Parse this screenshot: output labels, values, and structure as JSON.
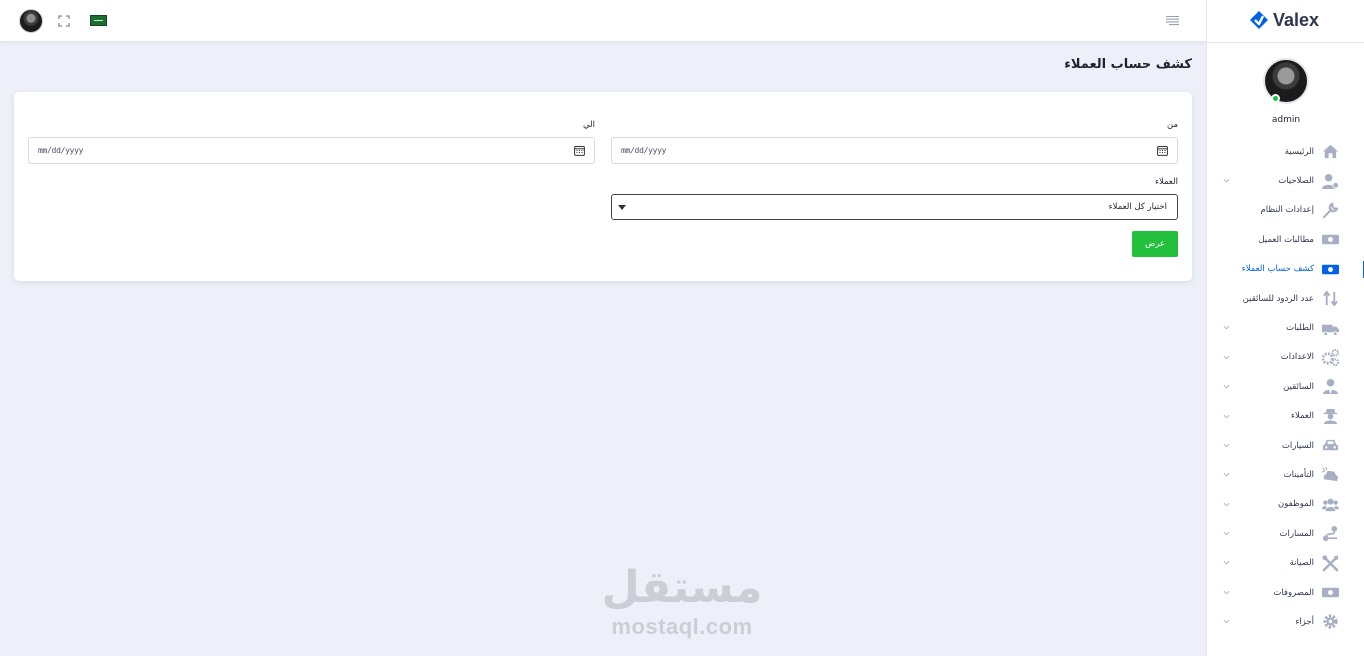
{
  "brand": {
    "name": "Valex"
  },
  "user": {
    "name": "admin"
  },
  "page": {
    "title": "كشف حساب العملاء"
  },
  "form": {
    "from_label": "من",
    "to_label": "الي",
    "from_placeholder": "mm/dd/yyyy",
    "to_placeholder": "mm/dd/yyyy",
    "customers_label": "العملاء",
    "customers_selected": "اختيار كل العملاء",
    "submit_label": "عرض"
  },
  "sidebar": {
    "items": [
      {
        "label": "الرئيسية",
        "icon": "home-icon",
        "has_submenu": false,
        "active": false
      },
      {
        "label": "الصلاحيات",
        "icon": "user-gear-icon",
        "has_submenu": true,
        "active": false
      },
      {
        "label": "إعدادات النظام",
        "icon": "wrench-icon",
        "has_submenu": false,
        "active": false
      },
      {
        "label": "مطالبات العميل",
        "icon": "money-bill-icon",
        "has_submenu": false,
        "active": false
      },
      {
        "label": "كشف حساب العملاء",
        "icon": "money-bill-icon",
        "has_submenu": false,
        "active": true
      },
      {
        "label": "عدد الردود للسائقين",
        "icon": "sort-icon",
        "has_submenu": false,
        "active": false
      },
      {
        "label": "الطلبات",
        "icon": "truck-icon",
        "has_submenu": true,
        "active": false
      },
      {
        "label": "الاعدادات",
        "icon": "gears-icon",
        "has_submenu": true,
        "active": false
      },
      {
        "label": "السائقين",
        "icon": "user-tie-icon",
        "has_submenu": true,
        "active": false
      },
      {
        "label": "العملاء",
        "icon": "user-secret-icon",
        "has_submenu": true,
        "active": false
      },
      {
        "label": "السيارات",
        "icon": "car-icon",
        "has_submenu": true,
        "active": false
      },
      {
        "label": "التأمينات",
        "icon": "car-crash-icon",
        "has_submenu": true,
        "active": false
      },
      {
        "label": "الموظفون",
        "icon": "users-icon",
        "has_submenu": true,
        "active": false
      },
      {
        "label": "المسارات",
        "icon": "route-icon",
        "has_submenu": true,
        "active": false
      },
      {
        "label": "الصيانة",
        "icon": "tools-icon",
        "has_submenu": true,
        "active": false
      },
      {
        "label": "المصروفات",
        "icon": "money-bill-icon",
        "has_submenu": true,
        "active": false
      },
      {
        "label": "أجزاء",
        "icon": "cog-icon",
        "has_submenu": true,
        "active": false
      }
    ]
  },
  "watermark": {
    "arabic": "مستقل",
    "latin": "mostaql.com"
  },
  "colors": {
    "accent": "#0162e8",
    "success": "#22c03c",
    "background": "#edf0f8",
    "icon": "#a7afc4"
  }
}
